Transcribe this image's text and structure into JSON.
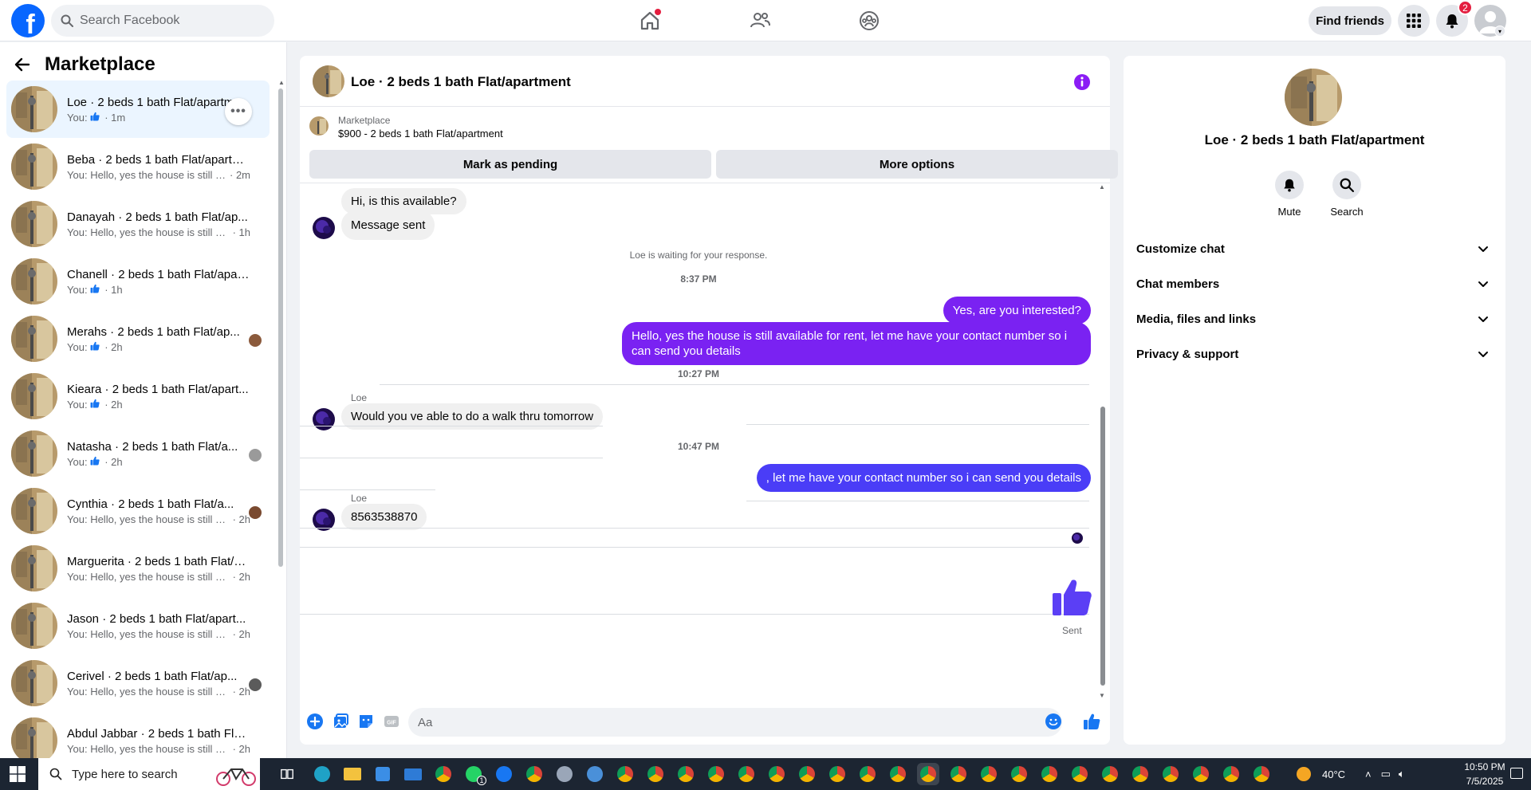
{
  "topbar": {
    "search_placeholder": "Search Facebook",
    "find_friends": "Find friends",
    "notification_count": "2"
  },
  "sidebar": {
    "title": "Marketplace",
    "conversations": [
      {
        "name": "Loe · 2 beds 1 bath Flat/apartment",
        "you": "You:",
        "preview": "",
        "like": true,
        "time": "· 1m"
      },
      {
        "name": "Beba · 2 beds 1 bath Flat/apartm...",
        "you": "You:",
        "preview": "Hello, yes the house is still av...",
        "like": false,
        "time": "· 2m"
      },
      {
        "name": "Danayah · 2 beds 1 bath Flat/ap...",
        "you": "You:",
        "preview": "Hello, yes the house is still avai...",
        "like": false,
        "time": "· 1h"
      },
      {
        "name": "Chanell · 2 beds 1 bath Flat/apar...",
        "you": "You:",
        "preview": "",
        "like": true,
        "time": "· 1h"
      },
      {
        "name": "Merahs · 2 beds 1 bath Flat/ap...",
        "you": "You:",
        "preview": "",
        "like": true,
        "time": "· 2h"
      },
      {
        "name": "Kieara · 2 beds 1 bath Flat/apart...",
        "you": "You:",
        "preview": "",
        "like": true,
        "time": "· 2h"
      },
      {
        "name": "Natasha · 2 beds 1 bath Flat/a...",
        "you": "You:",
        "preview": "",
        "like": true,
        "time": "· 2h"
      },
      {
        "name": "Cynthia · 2 beds 1 bath Flat/a...",
        "you": "You:",
        "preview": "Hello, yes the house is still a...",
        "like": false,
        "time": "· 2h"
      },
      {
        "name": "Marguerita · 2 beds 1 bath Flat/a...",
        "you": "You:",
        "preview": "Hello, yes the house is still avai...",
        "like": false,
        "time": "· 2h"
      },
      {
        "name": "Jason · 2 beds 1 bath Flat/apart...",
        "you": "You:",
        "preview": "Hello, yes the house is still avai...",
        "like": false,
        "time": "· 2h"
      },
      {
        "name": "Cerivel · 2 beds 1 bath Flat/ap...",
        "you": "You:",
        "preview": "Hello, yes the house is still a...",
        "like": false,
        "time": "· 2h"
      },
      {
        "name": "Abdul Jabbar · 2 beds 1 bath Flat...",
        "you": "You:",
        "preview": "Hello, yes the house is still avai...",
        "like": false,
        "time": "· 2h"
      }
    ]
  },
  "chat": {
    "title": "Loe · 2 beds 1 bath Flat/apartment",
    "listing_source": "Marketplace",
    "listing_item": "$900 - 2 beds 1 bath Flat/apartment",
    "mark_pending": "Mark as pending",
    "more_options": "More options",
    "messages": {
      "m1": "Hi, is this available?",
      "m2": "Message sent",
      "waiting": "Loe is waiting for your response.",
      "ts1": "8:37 PM",
      "m3": "Yes, are you interested?",
      "m4": "Hello, yes the house is still available for rent, let me have your contact number so i can send you details",
      "ts2": "10:27 PM",
      "sender1": "Loe",
      "m5": "Would you ve able to do a walk thru tomorrow",
      "ts3": "10:47 PM",
      "m6": ", let me have your contact number so i can send you details",
      "sender2": "Loe",
      "m7": "8563538870",
      "sent": "Sent"
    },
    "composer_placeholder": "Aa"
  },
  "right_panel": {
    "name": "Loe · 2 beds 1 bath Flat/apartment",
    "mute": "Mute",
    "search": "Search",
    "sections": [
      "Customize chat",
      "Chat members",
      "Media, files and links",
      "Privacy & support"
    ]
  },
  "taskbar": {
    "search_placeholder": "Type here to search",
    "temperature": "40°C",
    "time": "10:50 PM",
    "date": "7/5/2025",
    "whatsapp_badge": "1"
  },
  "colors": {
    "brand": "#0866ff",
    "outgoing_bubble": "#7a22f2",
    "outgoing_bubble_alt": "#4a3df7",
    "accent": "#1877f2"
  }
}
